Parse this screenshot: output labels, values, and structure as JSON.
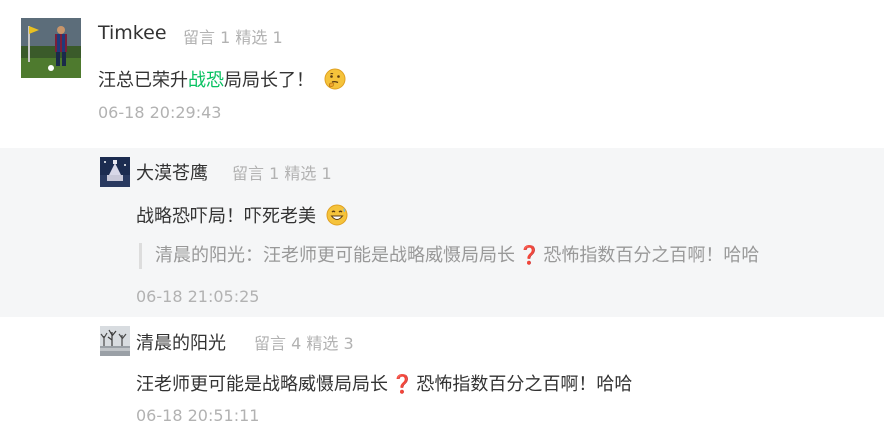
{
  "comment": {
    "user_name": "Timkee",
    "meta": "留言 1 精选 1",
    "content_pre": "汪总已荣升",
    "content_highlight": "战恐",
    "content_post": "局局长了！",
    "time": "06-18 20:29:43"
  },
  "reply1": {
    "user_name": "大漠苍鹰",
    "meta": "留言 1 精选 1",
    "content": "战略恐吓局！吓死老美",
    "quote_pre": "清晨的阳光：汪老师更可能是战略威慑局局长",
    "quote_mark": "❓",
    "quote_post": "恐怖指数百分之百啊！哈哈",
    "time": "06-18 21:05:25"
  },
  "reply2": {
    "user_name": "清晨的阳光",
    "meta": "留言 4 精选 3",
    "content_pre": "汪老师更可能是战略威慑局局长",
    "content_mark": "❓",
    "content_post": "恐怖指数百分之百啊！哈哈",
    "time": "06-18 20:51:11"
  },
  "colors": {
    "highlight": "#07c160",
    "meta": "#b2b2b2",
    "reply_bg": "#f5f6f7",
    "question_mark": "#d9232e"
  },
  "icons": {
    "thinking_emoji": "thinking-face-icon",
    "grin_emoji": "grinning-sweat-icon",
    "question_mark": "question-mark-icon"
  }
}
